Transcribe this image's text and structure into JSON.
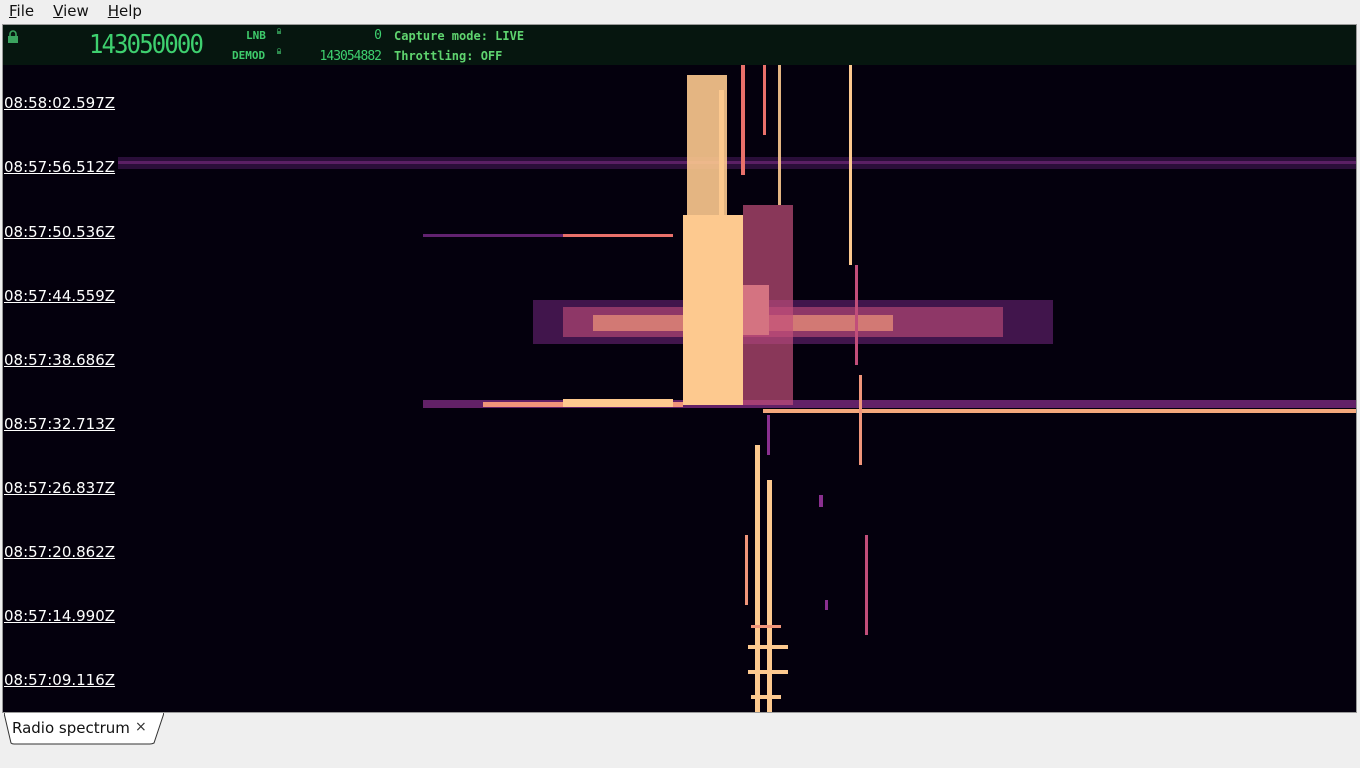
{
  "menu": [
    {
      "mnemonic": "F",
      "rest": "ile"
    },
    {
      "mnemonic": "V",
      "rest": "iew"
    },
    {
      "mnemonic": "H",
      "rest": "elp"
    }
  ],
  "status": {
    "frequency": "143050000",
    "lnb_label": "LNB",
    "demod_label": "DEMOD",
    "lnb_value": "0",
    "demod_value": "143054882",
    "capture_mode": "Capture mode: LIVE",
    "throttling": "Throttling: OFF",
    "text_color": "#3ed06f"
  },
  "timestamps": [
    "08:58:02.597Z",
    "08:57:56.512Z",
    "08:57:50.536Z",
    "08:57:44.559Z",
    "08:57:38.686Z",
    "08:57:32.713Z",
    "08:57:26.837Z",
    "08:57:20.862Z",
    "08:57:14.990Z",
    "08:57:09.116Z"
  ],
  "tabs": [
    {
      "label": "Radio spectrum",
      "close": "×"
    }
  ],
  "colors": {
    "waterfall_bg": "#04000d",
    "signal_hot": "#fdc98f",
    "signal_mid": "#e9706a",
    "signal_low": "#8a2f8f"
  }
}
